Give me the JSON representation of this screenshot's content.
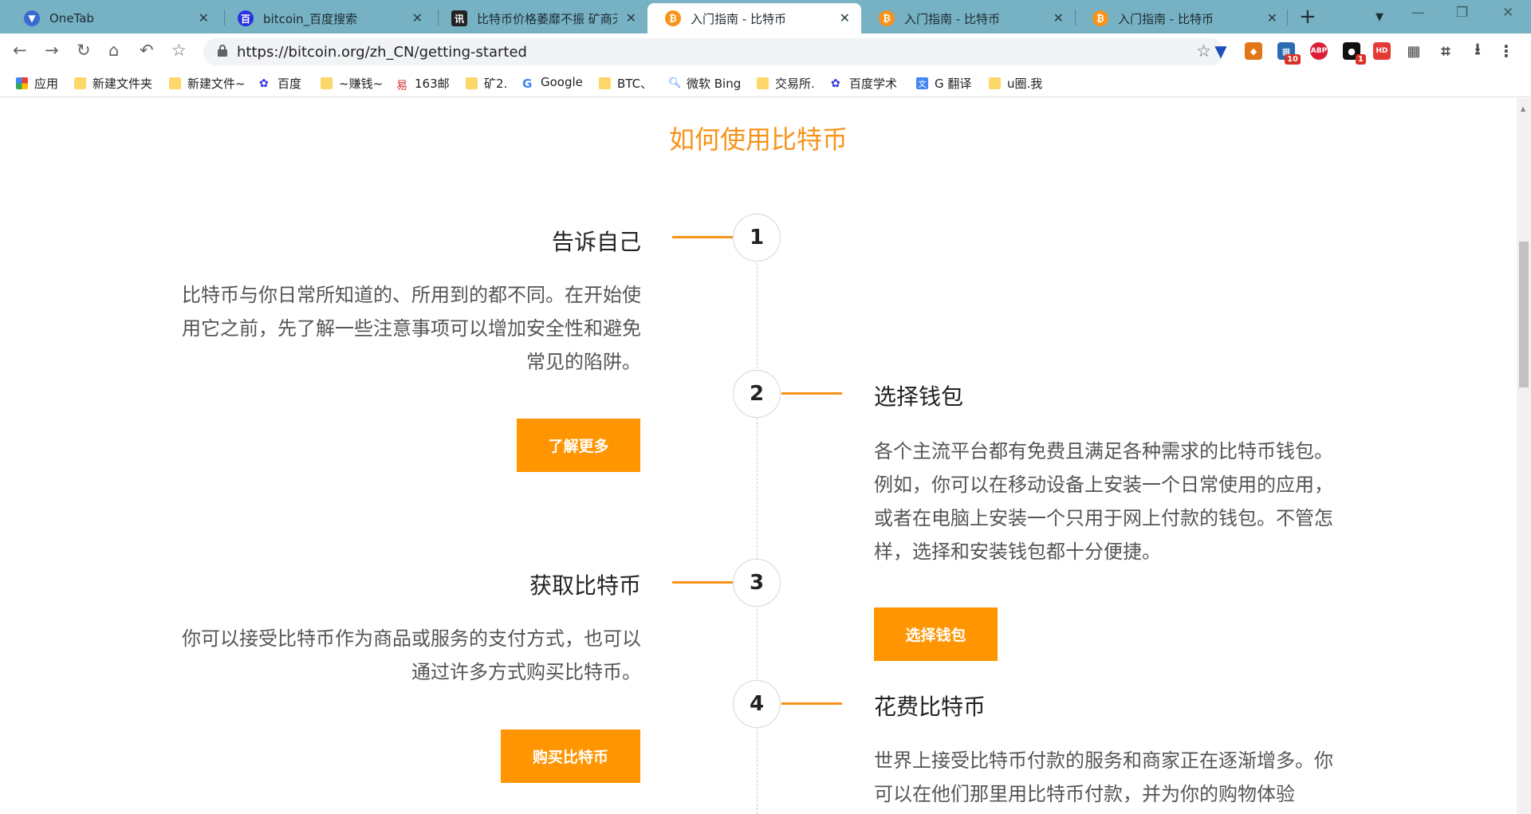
{
  "browser": {
    "tabs": [
      {
        "title": "OneTab",
        "icon": "onetab-icon"
      },
      {
        "title": "bitcoin_百度搜索",
        "icon": "baidu-icon"
      },
      {
        "title": "比特币价格萎靡不振 矿商无",
        "icon": "news-icon"
      },
      {
        "title": "入门指南 - 比特币",
        "icon": "bitcoin-icon",
        "active": true
      },
      {
        "title": "入门指南 - 比特币",
        "icon": "bitcoin-icon"
      },
      {
        "title": "入门指南 - 比特币",
        "icon": "bitcoin-icon"
      }
    ],
    "url": "https://bitcoin.org/zh_CN/getting-started",
    "extension_badges": {
      "ext1": "10",
      "ext2": "1"
    },
    "extension_labels": {
      "abp": "ABP",
      "hd": "HD"
    },
    "bookmarks": [
      {
        "label": "应用",
        "icon": "apps-grid-icon"
      },
      {
        "label": "新建文件夹",
        "icon": "folder-icon"
      },
      {
        "label": "新建文件~",
        "icon": "folder-icon"
      },
      {
        "label": "百度",
        "icon": "baidu-icon"
      },
      {
        "label": "~赚钱~",
        "icon": "folder-icon"
      },
      {
        "label": "163邮",
        "icon": "netease-icon"
      },
      {
        "label": "矿2.",
        "icon": "folder-icon"
      },
      {
        "label": "Google",
        "icon": "google-icon"
      },
      {
        "label": "BTC、",
        "icon": "folder-icon"
      },
      {
        "label": "微软 Bing",
        "icon": "bing-search-icon"
      },
      {
        "label": "交易所.",
        "icon": "folder-icon"
      },
      {
        "label": "百度学术",
        "icon": "baidu-icon"
      },
      {
        "label": "G 翻译",
        "icon": "google-translate-icon"
      },
      {
        "label": "u圈.我",
        "icon": "folder-icon"
      }
    ]
  },
  "page": {
    "section_title": "如何使用比特币",
    "accent_color": "#f7931a",
    "button_color": "#ff9500",
    "steps": [
      {
        "number": "1",
        "title": "告诉自己",
        "description": "比特币与你日常所知道的、所用到的都不同。在开始使用它之前，先了解一些注意事项可以增加安全性和避免常见的陷阱。",
        "button": "了解更多"
      },
      {
        "number": "2",
        "title": "选择钱包",
        "description": "各个主流平台都有免费且满足各种需求的比特币钱包。例如，你可以在移动设备上安装一个日常使用的应用，或者在电脑上安装一个只用于网上付款的钱包。不管怎样，选择和安装钱包都十分便捷。",
        "button": "选择钱包"
      },
      {
        "number": "3",
        "title": "获取比特币",
        "description": "你可以接受比特币作为商品或服务的支付方式，也可以通过许多方式购买比特币。",
        "button": "购买比特币"
      },
      {
        "number": "4",
        "title": "花费比特币",
        "description": "世界上接受比特币付款的服务和商家正在逐渐增多。你可以在他们那里用比特币付款，并为你的购物体验"
      }
    ]
  }
}
